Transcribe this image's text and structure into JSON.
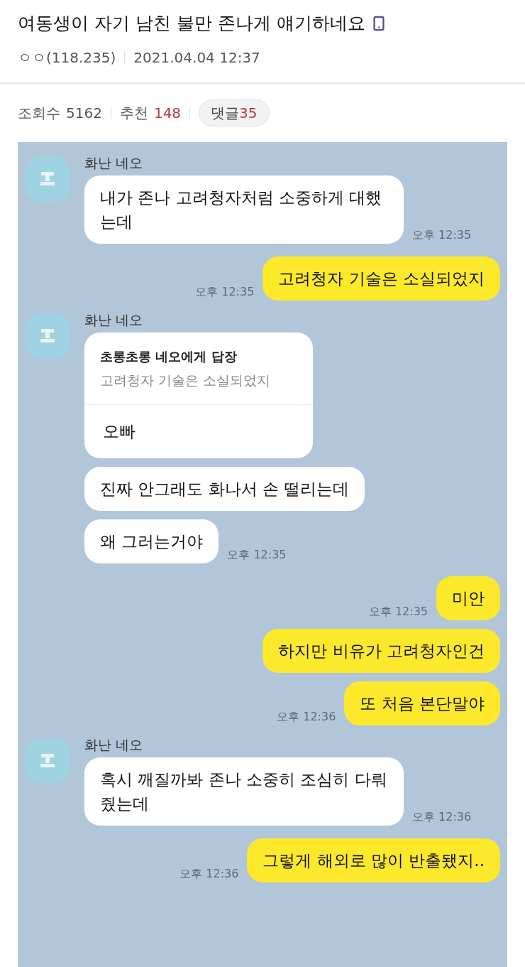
{
  "post": {
    "title": "여동생이 자기 남친 불만 존나게 얘기하네요",
    "author": "ㅇㅇ(118.235)",
    "date": "2021.04.04 12:37",
    "stats": {
      "views_label": "조회수",
      "views": "5162",
      "recommend_label": "추천",
      "recommend": "148",
      "comments_label": "댓글",
      "comments": "35"
    }
  },
  "chat": {
    "messages": [
      {
        "kind": "received",
        "sender": "화난 네오",
        "text": "내가 존나 고려청자처럼 소중하게 대했는데",
        "time": "오후 12:35"
      },
      {
        "kind": "sent",
        "text": "고려청자 기술은 소실되었지",
        "time": "오후 12:35"
      },
      {
        "kind": "received",
        "sender": "화난 네오",
        "reply": {
          "to": "초롱초롱 네오에게 답장",
          "quote": "고려청자 기술은 소실되었지"
        },
        "text": "오빠"
      },
      {
        "kind": "received",
        "text": "진짜 안그래도 화나서 손 떨리는데"
      },
      {
        "kind": "received",
        "text": "왜 그러는거야",
        "time": "오후 12:35"
      },
      {
        "kind": "sent",
        "text": "미안",
        "time": "오후 12:35"
      },
      {
        "kind": "sent",
        "text": "하지만 비유가 고려청자인건"
      },
      {
        "kind": "sent",
        "text": "또 처음 본단말야",
        "time": "오후 12:36"
      },
      {
        "kind": "received",
        "sender": "화난 네오",
        "text": "혹시 깨질까봐 존나 소중히 조심히 다뤄줬는데",
        "time": "오후 12:36"
      },
      {
        "kind": "sent",
        "text": "그렇게 해외로 많이 반출됐지..",
        "time": "오후 12:36"
      }
    ]
  }
}
